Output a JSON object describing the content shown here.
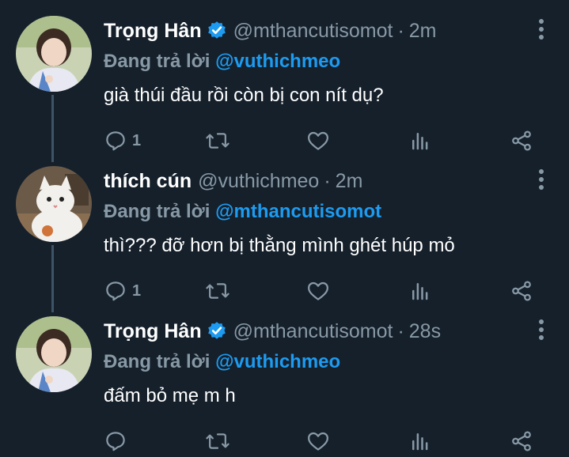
{
  "tweets": [
    {
      "name": "Trọng Hân",
      "verified": true,
      "handle": "@mthancutisomot",
      "time": "2m",
      "reply_prefix": "Đang trả lời",
      "reply_mention": "@vuthichmeo",
      "text": "già thúi đầu rồi còn bị con nít dụ?",
      "reply_count": "1",
      "avatar": "person-avatar"
    },
    {
      "name": "thích cún",
      "verified": false,
      "handle": "@vuthichmeo",
      "time": "2m",
      "reply_prefix": "Đang trả lời",
      "reply_mention": "@mthancutisomot",
      "text": "thì??? đỡ hơn bị thằng mình ghét húp mỏ",
      "reply_count": "1",
      "avatar": "cat-avatar"
    },
    {
      "name": "Trọng Hân",
      "verified": true,
      "handle": "@mthancutisomot",
      "time": "28s",
      "reply_prefix": "Đang trả lời",
      "reply_mention": "@vuthichmeo",
      "text": "đấm bỏ mẹ m h",
      "reply_count": "",
      "avatar": "person-avatar"
    }
  ],
  "colors": {
    "background": "#15202b",
    "secondary_text": "#8899a6",
    "accent": "#1d9bf0",
    "thread_line": "#3d5466"
  },
  "icons": [
    "reply-icon",
    "retweet-icon",
    "like-icon",
    "analytics-icon",
    "share-icon",
    "more-icon",
    "verified-icon"
  ]
}
